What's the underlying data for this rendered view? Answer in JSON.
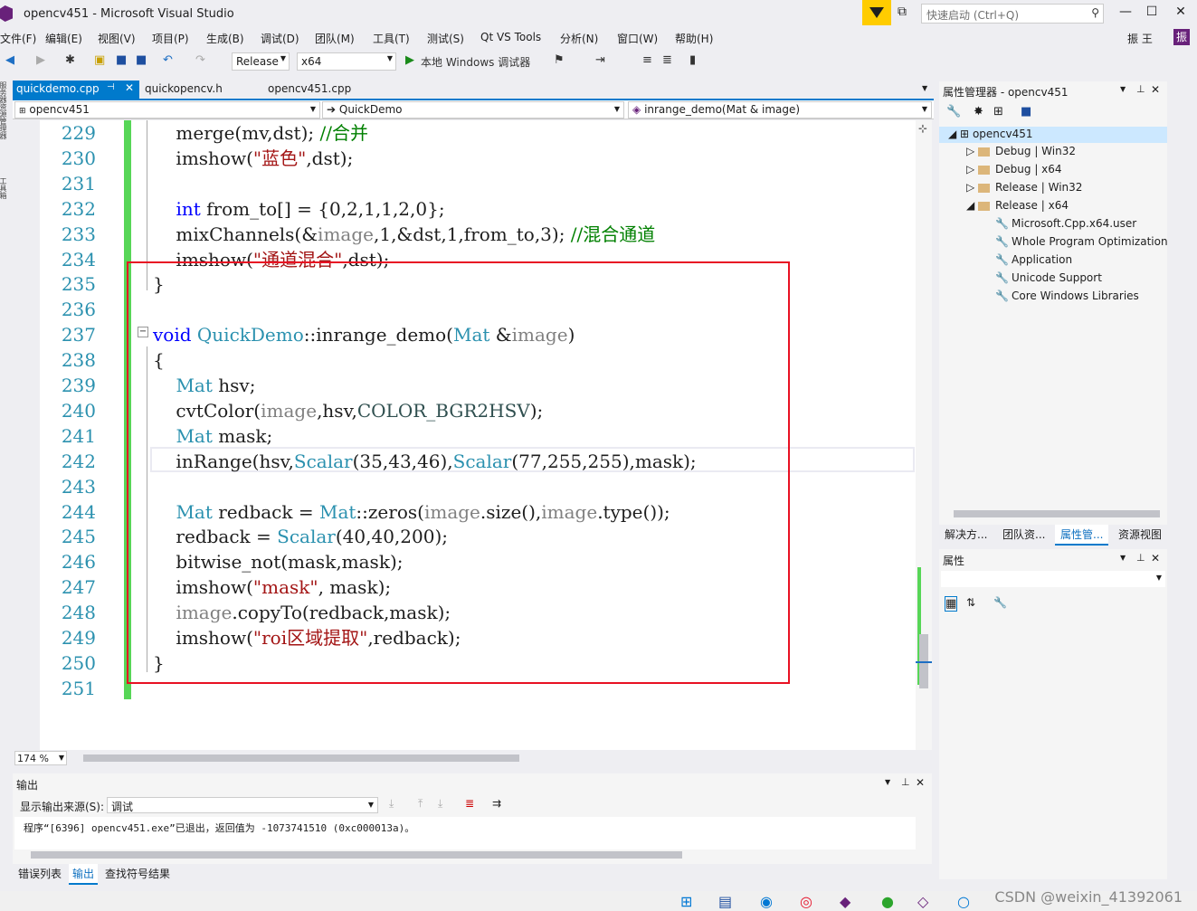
{
  "window": {
    "title": "opencv451 - Microsoft Visual Studio",
    "quick_launch_placeholder": "快速启动 (Ctrl+Q)",
    "user": "振 王",
    "user_badge": "振"
  },
  "menu": [
    "文件(F)",
    "编辑(E)",
    "视图(V)",
    "项目(P)",
    "生成(B)",
    "调试(D)",
    "团队(M)",
    "工具(T)",
    "测试(S)",
    "Qt VS Tools",
    "分析(N)",
    "窗口(W)",
    "帮助(H)"
  ],
  "toolbar": {
    "config": "Release",
    "platform": "x64",
    "run_label": "本地 Windows 调试器"
  },
  "tabs": [
    {
      "label": "quickdemo.cpp",
      "active": true
    },
    {
      "label": "quickopencv.h",
      "active": false
    },
    {
      "label": "opencv451.cpp",
      "active": false
    }
  ],
  "nav": {
    "project": "opencv451",
    "scope": "QuickDemo",
    "member": "inrange_demo(Mat & image)"
  },
  "editor": {
    "zoom": "174 %",
    "lines": [
      {
        "n": "229",
        "html": "    merge(mv,dst); <span class='cm'>//合并</span>"
      },
      {
        "n": "230",
        "html": "    imshow(<span class='st'>\"蓝色\"</span>,dst);"
      },
      {
        "n": "231",
        "html": ""
      },
      {
        "n": "232",
        "html": "    <span class='kw'>int</span> from_to[] = {0,2,1,1,2,0};"
      },
      {
        "n": "233",
        "html": "    mixChannels(&amp;<span class='pa'>image</span>,1,&amp;dst,1,from_to,3); <span class='cm'>//混合通道</span>"
      },
      {
        "n": "234",
        "html": "    imshow(<span class='st'>\"通道混合\"</span>,dst);"
      },
      {
        "n": "235",
        "html": "}"
      },
      {
        "n": "236",
        "html": ""
      },
      {
        "n": "237",
        "html": "<span class='kw'>void</span> <span class='ty'>QuickDemo</span>::inrange_demo(<span class='ty'>Mat</span> &amp;<span class='pa'>image</span>)"
      },
      {
        "n": "238",
        "html": "{"
      },
      {
        "n": "239",
        "html": "    <span class='ty'>Mat</span> hsv;"
      },
      {
        "n": "240",
        "html": "    cvtColor(<span class='pa'>image</span>,hsv,<span class='en'>COLOR_BGR2HSV</span>);"
      },
      {
        "n": "241",
        "html": "    <span class='ty'>Mat</span> mask;"
      },
      {
        "n": "242",
        "html": "    inRange(hsv,<span class='ty'>Scalar</span>(35,43,46),<span class='ty'>Scalar</span>(77,255,255),mask);"
      },
      {
        "n": "243",
        "html": ""
      },
      {
        "n": "244",
        "html": "    <span class='ty'>Mat</span> redback = <span class='ty'>Mat</span>::zeros(<span class='pa'>image</span>.size(),<span class='pa'>image</span>.type());"
      },
      {
        "n": "245",
        "html": "    redback = <span class='ty'>Scalar</span>(40,40,200);"
      },
      {
        "n": "246",
        "html": "    bitwise_not(mask,mask);"
      },
      {
        "n": "247",
        "html": "    imshow(<span class='st'>\"mask\"</span>, mask);"
      },
      {
        "n": "248",
        "html": "    <span class='pa'>image</span>.copyTo(redback,mask);"
      },
      {
        "n": "249",
        "html": "    imshow(<span class='st'>\"roi区域提取\"</span>,redback);"
      },
      {
        "n": "250",
        "html": "}"
      },
      {
        "n": "251",
        "html": ""
      }
    ]
  },
  "property_manager": {
    "title": "属性管理器 - opencv451",
    "root": "opencv451",
    "configs": [
      "Debug | Win32",
      "Debug | x64",
      "Release | Win32",
      "Release | x64"
    ],
    "sheets": [
      "Microsoft.Cpp.x64.user",
      "Whole Program Optimization",
      "Application",
      "Unicode Support",
      "Core Windows Libraries"
    ]
  },
  "right_tabs": [
    "解决方...",
    "团队资...",
    "属性管...",
    "资源视图"
  ],
  "properties": {
    "title": "属性"
  },
  "output": {
    "title": "输出",
    "source_label": "显示输出来源(S):",
    "source_value": "调试",
    "text": "程序“[6396] opencv451.exe”已退出，返回值为 -1073741510 (0xc000013a)。"
  },
  "output_tabs": [
    "错误列表",
    "输出",
    "查找符号结果"
  ],
  "watermark": "CSDN @weixin_41392061"
}
